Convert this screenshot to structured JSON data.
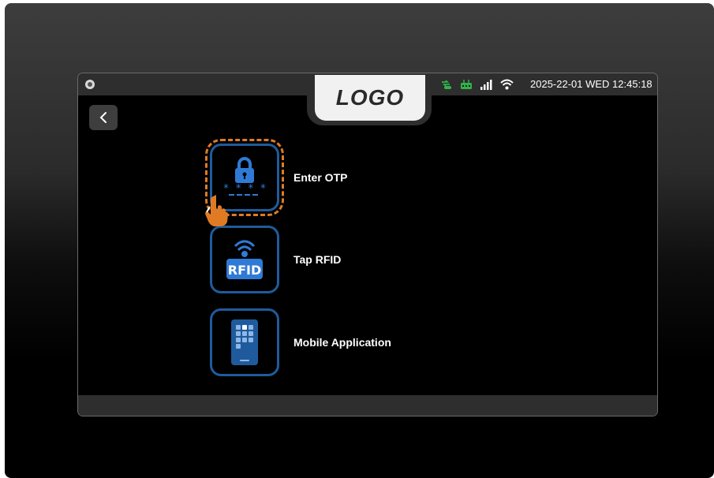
{
  "status_bar": {
    "datetime": "2025-22-01 WED 12:45:18",
    "icons": [
      "camera-icon",
      "cloud-sync-icon",
      "router-icon",
      "signal-icon",
      "wifi-icon"
    ],
    "indicator_color": "#2fb34a"
  },
  "header": {
    "logo_text": "LOGO"
  },
  "nav": {
    "back_icon": "chevron-left-icon"
  },
  "options": [
    {
      "label": "Enter OTP",
      "icon": "lock-otp-icon",
      "selected": true
    },
    {
      "label": "Tap RFID",
      "icon": "rfid-icon",
      "selected": false
    },
    {
      "label": "Mobile Application",
      "icon": "mobile-app-icon",
      "selected": false
    }
  ],
  "colors": {
    "accent_blue": "#1f5b9c",
    "icon_blue": "#2f7ad6",
    "selection_orange": "#e07b24"
  }
}
